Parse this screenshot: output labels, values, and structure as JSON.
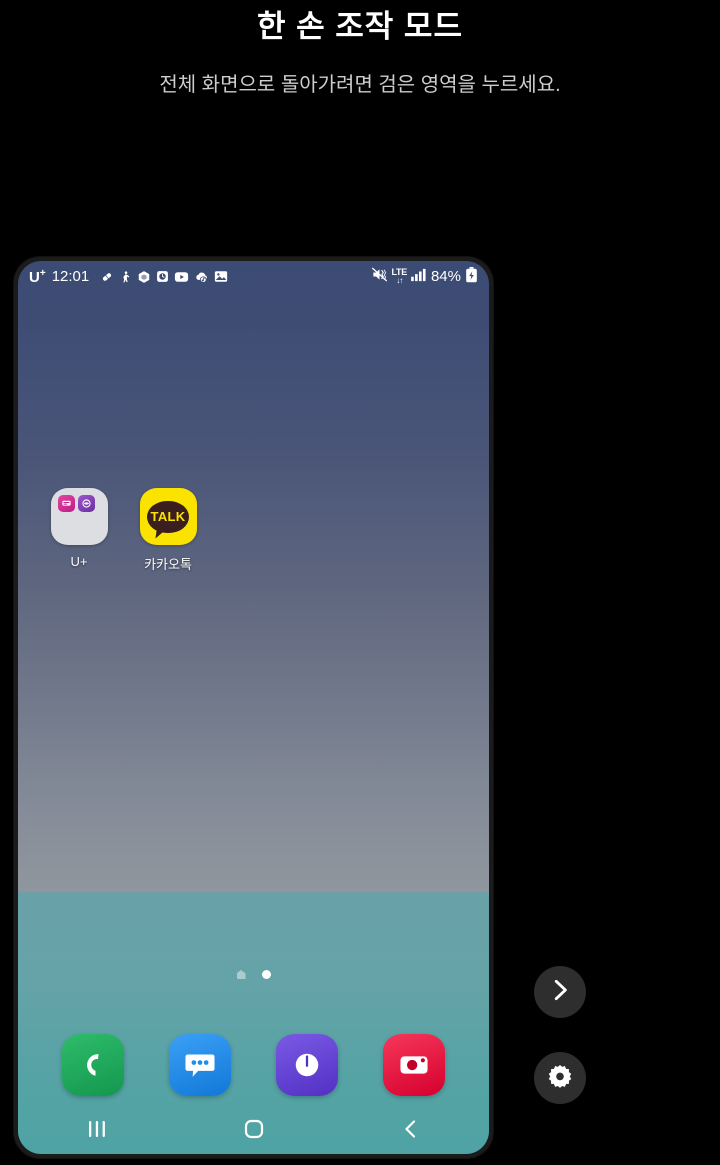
{
  "header": {
    "title": "한 손 조작 모드",
    "subtitle": "전체 화면으로 돌아가려면 검은 영역을 누르세요."
  },
  "phone": {
    "status_bar": {
      "carrier": "U",
      "carrier_sup": "+",
      "clock": "12:01",
      "notification_icons": [
        "pill-icon",
        "person-walking-icon",
        "cube-icon",
        "clock-square-icon",
        "youtube-icon",
        "music-cloud-icon",
        "gallery-icon"
      ],
      "mute_icon": "mute-vibrate-icon",
      "network": "LTE",
      "network_arrows": "↓↑",
      "signal_icon": "signal-bars-icon",
      "battery_percent": "84%",
      "battery_icon": "battery-charging-icon"
    },
    "apps": [
      {
        "label": "U+",
        "type": "folder",
        "icon_name": "folder-uplus",
        "bg": "#dcdee1",
        "mini_icons": [
          {
            "name": "uplus-pink-app",
            "color": "#d6268e",
            "glyph": "▭"
          },
          {
            "name": "uplus-purple-app",
            "color": "#7c3fb5",
            "glyph": "◕"
          }
        ]
      },
      {
        "label": "카카오톡",
        "type": "app",
        "icon_name": "kakaotalk-icon",
        "bg": "#fbe300",
        "bubble_text": "TALK",
        "bubble_color": "#3b1e1e"
      }
    ],
    "page_indicator": {
      "dots": [
        {
          "name": "home-page-dot",
          "type": "home",
          "active": false
        },
        {
          "name": "page-dot",
          "type": "dot",
          "active": true
        }
      ]
    },
    "dock": [
      {
        "name": "phone-app-icon",
        "label": "Phone",
        "color": "#25ab5e",
        "glyph": "phone"
      },
      {
        "name": "messages-app-icon",
        "label": "Messages",
        "color": "#1f8eea",
        "glyph": "message"
      },
      {
        "name": "internet-app-icon",
        "label": "Internet",
        "color": "#6242d4",
        "glyph": "internet"
      },
      {
        "name": "camera-app-icon",
        "label": "Camera",
        "color": "#e8203f",
        "glyph": "camera"
      }
    ],
    "nav_bar": [
      {
        "name": "recents-button",
        "label": "Recents",
        "glyph": "recents"
      },
      {
        "name": "home-button",
        "label": "Home",
        "glyph": "home"
      },
      {
        "name": "back-button",
        "label": "Back",
        "glyph": "back"
      }
    ]
  },
  "floating_controls": [
    {
      "name": "move-to-other-side-button",
      "label": "Move",
      "icon": "chevron-right-icon"
    },
    {
      "name": "one-handed-settings-button",
      "label": "Settings",
      "icon": "gear-icon"
    }
  ],
  "colors": {
    "page_bg": "#000000",
    "title": "#ffffff",
    "subtitle": "#cdcdcd",
    "wallpaper_top": "#3c4b73",
    "wallpaper_mid": "#8f969d",
    "wallpaper_bottom": "#4fa3a4",
    "fab_bg": "#2e2e2e"
  }
}
